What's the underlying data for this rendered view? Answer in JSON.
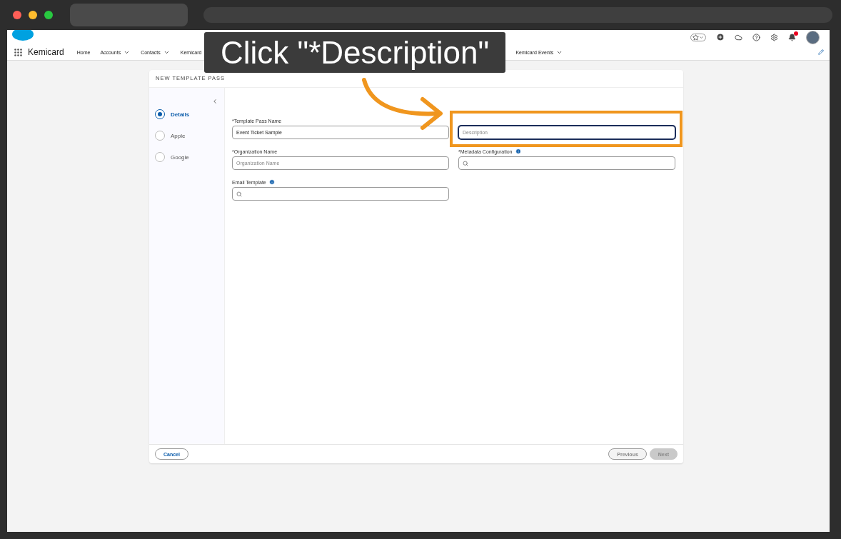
{
  "header": {
    "app_name": "Kemicard",
    "nav": [
      {
        "label": "Home",
        "dropdown": false
      },
      {
        "label": "Accounts",
        "dropdown": true
      },
      {
        "label": "Contacts",
        "dropdown": true
      },
      {
        "label": "Kemicard",
        "dropdown": false
      },
      {
        "label": "Kemicard Events",
        "dropdown": true
      }
    ],
    "notifications": true
  },
  "callout": {
    "text": "Click \"*Description\""
  },
  "form": {
    "title": "NEW TEMPLATE PASS",
    "steps": [
      {
        "label": "Details",
        "selected": true
      },
      {
        "label": "Apple",
        "selected": false
      },
      {
        "label": "Google",
        "selected": false
      }
    ],
    "fields": [
      {
        "kind": "text",
        "label": "*Template Pass Name",
        "info": false,
        "value": "Event Ticket Sample",
        "focused": false,
        "highlighted": false
      },
      {
        "kind": "text",
        "placeholder": "Description",
        "focused": true,
        "highlighted": true
      },
      {
        "kind": "text",
        "label": "*Organization Name",
        "info": false,
        "placeholder": "Organization Name",
        "focused": false,
        "highlighted": false
      },
      {
        "kind": "lookup",
        "label": "*Metadata Configuration",
        "info": true,
        "focused": false,
        "highlighted": false
      },
      {
        "kind": "lookup",
        "label": "Email Template",
        "info": true,
        "focused": false,
        "highlighted": false
      }
    ],
    "buttons": [
      {
        "label": "Cancel",
        "kind": "neutral",
        "disabled": false
      },
      {
        "label": "Previous",
        "kind": "neutral",
        "disabled": true
      },
      {
        "label": "Next",
        "kind": "brand",
        "disabled": true
      }
    ]
  }
}
